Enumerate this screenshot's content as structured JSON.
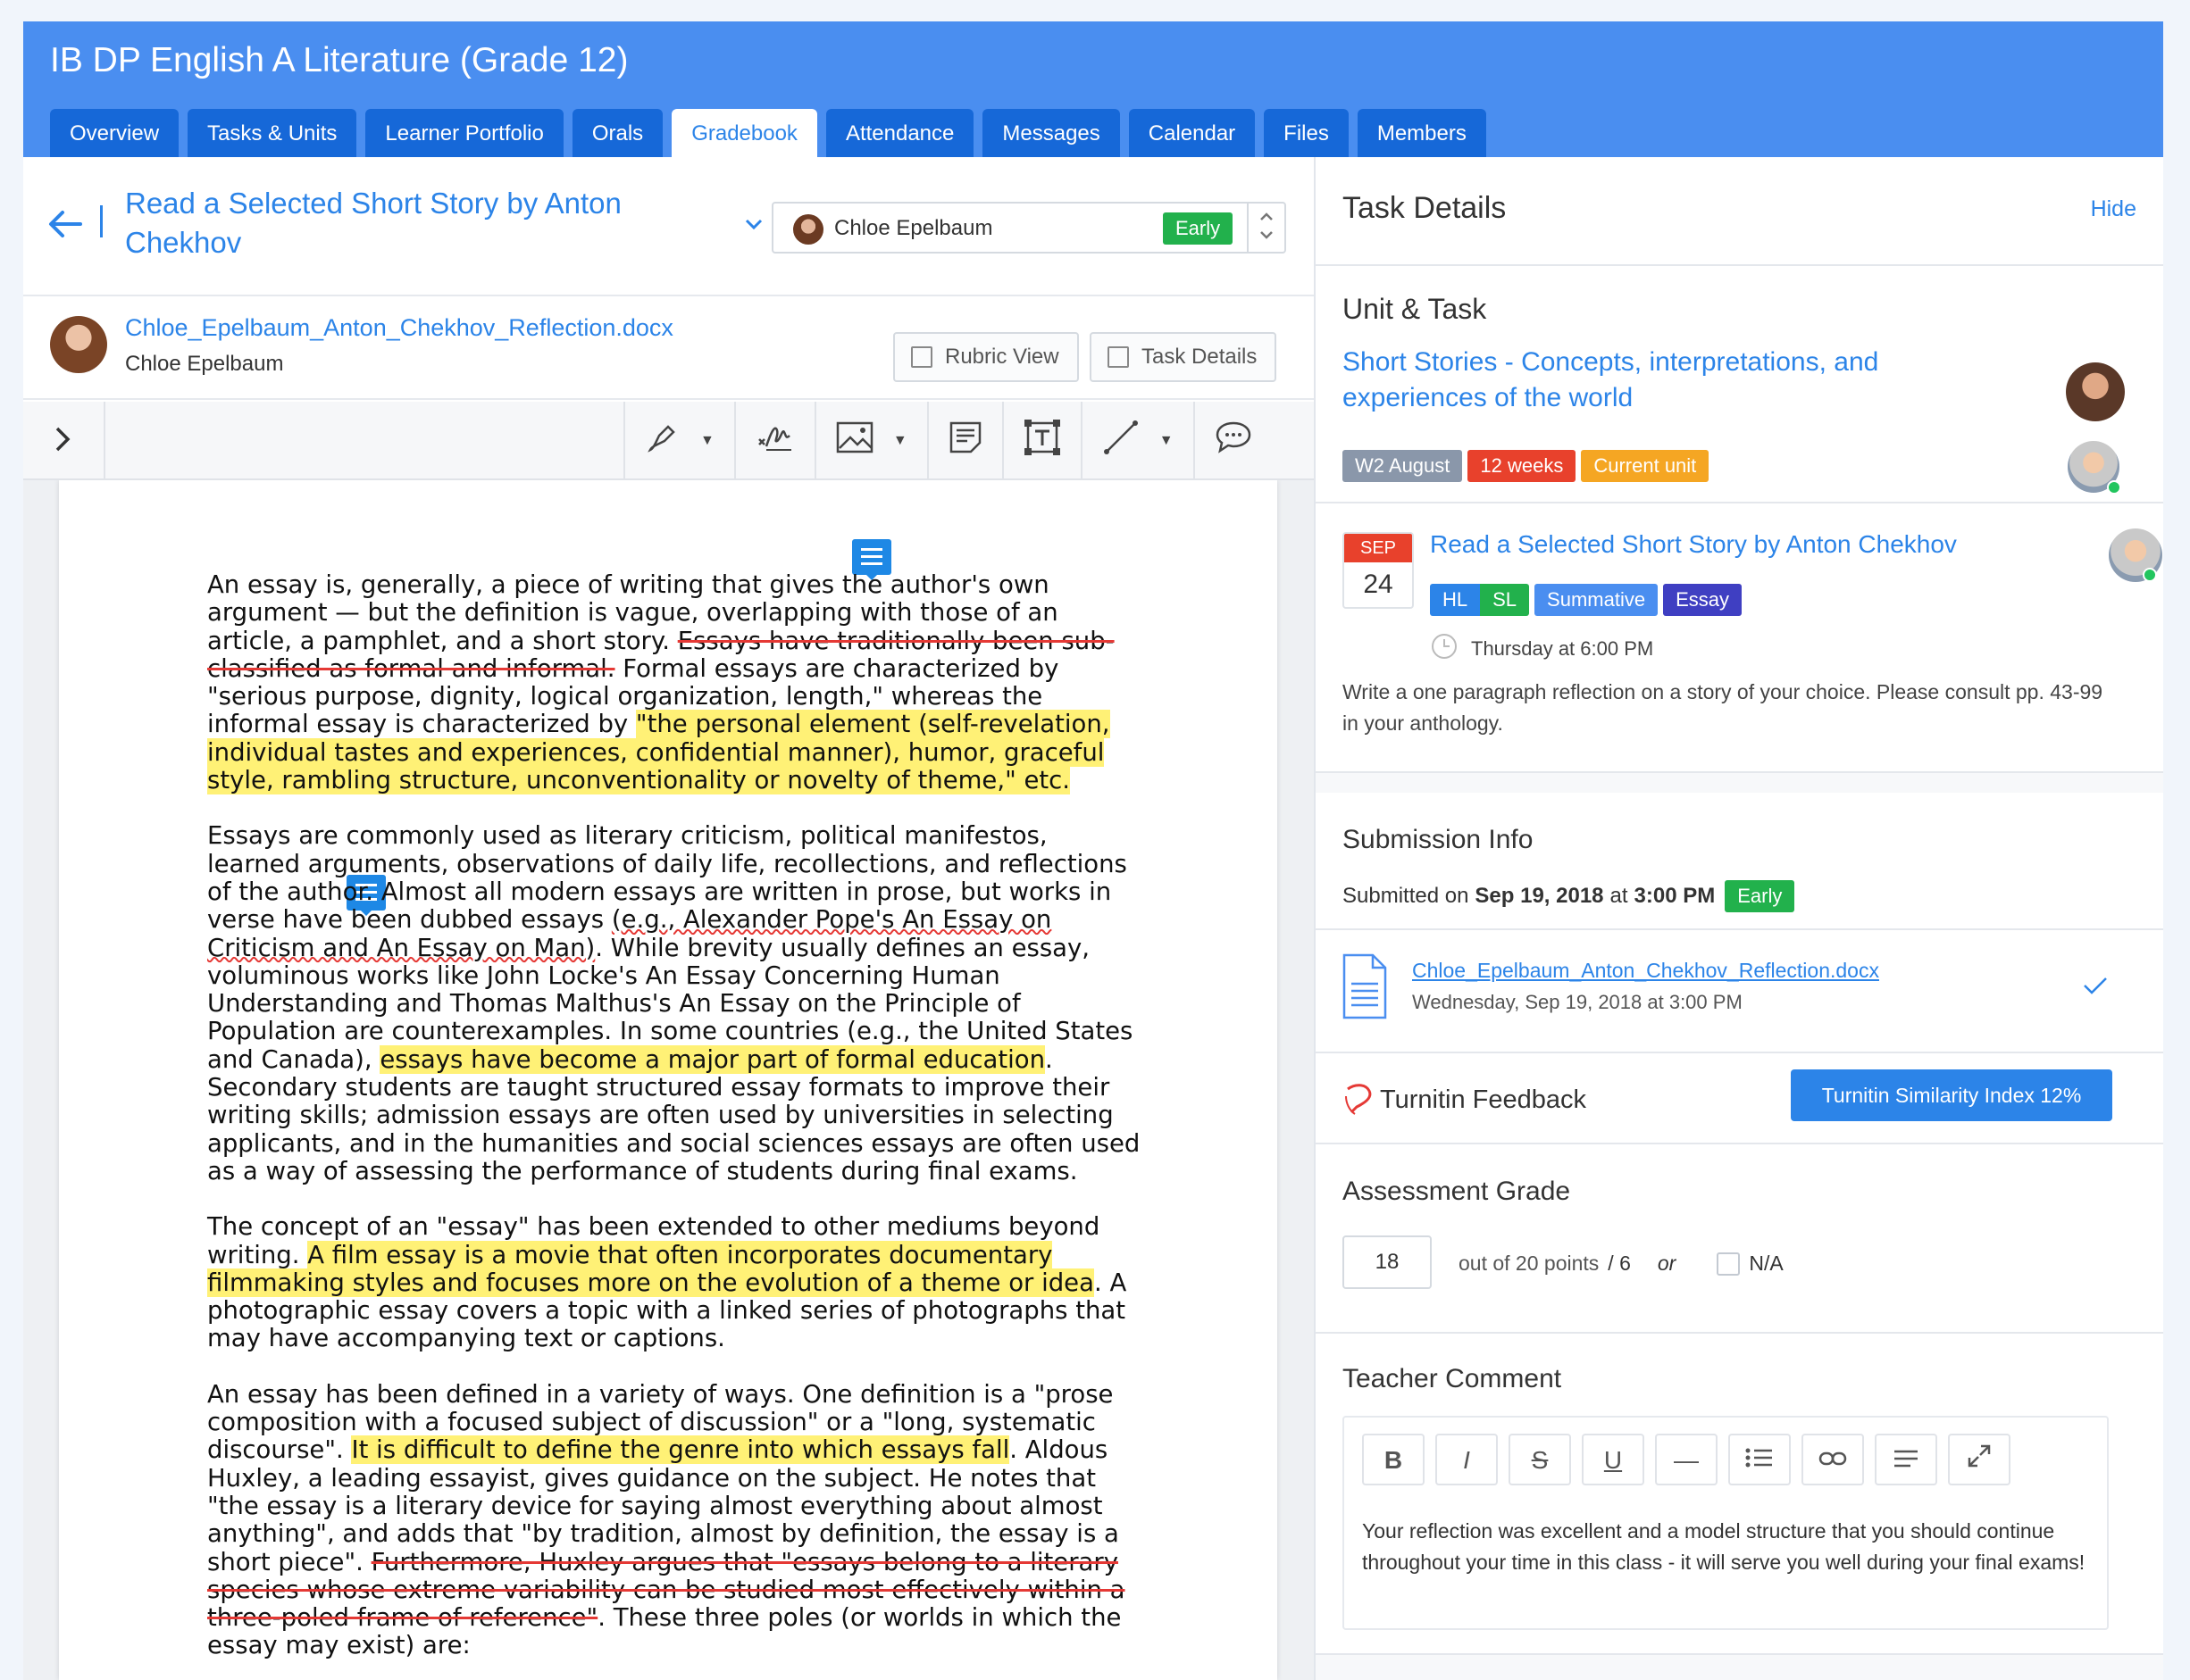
{
  "course_title": "IB DP English A Literature (Grade 12)",
  "tabs": [
    {
      "label": "Overview"
    },
    {
      "label": "Tasks & Units"
    },
    {
      "label": "Learner Portfolio"
    },
    {
      "label": "Orals"
    },
    {
      "label": "Gradebook",
      "active": true
    },
    {
      "label": "Attendance"
    },
    {
      "label": "Messages"
    },
    {
      "label": "Calendar"
    },
    {
      "label": "Files"
    },
    {
      "label": "Members"
    }
  ],
  "task": {
    "title": "Read a Selected Short Story by Anton Chekhov",
    "student_name": "Chloe Epelbaum",
    "status_badge": "Early"
  },
  "file": {
    "name": "Chloe_Epelbaum_Anton_Chekhov_Reflection.docx",
    "student": "Chloe Epelbaum",
    "rubric_view_label": "Rubric View",
    "task_details_label": "Task Details"
  },
  "document": {
    "p1": [
      {
        "t": "An essay is, generally, a piece of writing that gives the author's own argument — but the definition is vague, overlapping with those of an article, a pamphlet, and a short story. "
      },
      {
        "t": "Essays have traditionally been sub-classified as formal and informal.",
        "s": "st"
      },
      {
        "t": " Formal essays are characterized by \"serious purpose, dignity, logical organization, length,\" whereas the informal essay is characterized by "
      },
      {
        "t": "\"the personal element (self-revelation, individual tastes and experiences, confidential manner), humor, graceful style, rambling structure, unconventionality or novelty of theme,\" etc.",
        "s": "hl"
      }
    ],
    "p2": [
      {
        "t": "Essays are commonly used as literary criticism, political manifestos, learned arguments, observations of daily life, recollections, and reflections of the author. Almost all modern essays are written in prose, but works in verse have been dubbed essays "
      },
      {
        "t": "(e.g., Alexander Pope's An Essay on Criticism and An Essay on Man)",
        "s": "sq"
      },
      {
        "t": ". While brevity usually defines an essay, voluminous works like John Locke's An Essay Concerning Human Understanding and Thomas Malthus's An Essay on the Principle of Population are counterexamples. In some countries (e.g., the United States and Canada), "
      },
      {
        "t": "essays have become a major part of formal education",
        "s": "hl"
      },
      {
        "t": ". Secondary students are taught structured essay formats to improve their writing skills; admission essays are often used by universities in selecting applicants, and in the humanities and social sciences essays are often used as a way of assessing the performance of students during final exams."
      }
    ],
    "p3": [
      {
        "t": "The concept of an \"essay\" has been extended to other mediums beyond writing. "
      },
      {
        "t": "A film essay is a movie that often incorporates documentary filmmaking styles and focuses more on the evolution of a theme or idea",
        "s": "hl"
      },
      {
        "t": ". A photographic essay covers a topic with a linked series of photographs that may have accompanying text or captions."
      }
    ],
    "p4": [
      {
        "t": "An essay has been defined in a variety of ways. One definition is a \"prose composition with a focused subject of discussion\" or a \"long, systematic discourse\". "
      },
      {
        "t": "It is difficult to define the genre into which essays fall",
        "s": "hl"
      },
      {
        "t": ". Aldous Huxley, a leading essayist, gives guidance on the subject. He notes that \"the essay is a literary device for saying almost everything about almost anything\", and adds that \"by tradition, almost by definition, the essay is a short piece\". "
      },
      {
        "t": "Furthermore, Huxley argues that \"essays belong to a literary species whose extreme variability can be studied most effectively within a three-poled frame of reference\"",
        "s": "st"
      },
      {
        "t": ". These three poles (or worlds in which the essay may exist) are:"
      }
    ]
  },
  "details": {
    "title": "Task Details",
    "hide_label": "Hide",
    "unit_heading": "Unit & Task",
    "unit_name": "Short Stories - Concepts, interpretations, and experiences of the world",
    "unit_tags": [
      {
        "label": "W2 August",
        "color": "#8a97aa"
      },
      {
        "label": "12 weeks",
        "color": "#e8412c"
      },
      {
        "label": "Current unit",
        "color": "#f5a623"
      }
    ],
    "unit_progress": 0.16,
    "due_month": "SEP",
    "due_day": "24",
    "task_name": "Read a Selected Short Story by Anton Chekhov",
    "task_tags": [
      {
        "label": "HL",
        "color": "#2c84e8"
      },
      {
        "label": "SL",
        "color": "#22b14c"
      },
      {
        "label": "Summative",
        "color": "#4a8ef0"
      },
      {
        "label": "Essay",
        "color": "#3f3fc2"
      }
    ],
    "due_time": "Thursday at 6:00 PM",
    "description": "Write a one paragraph reflection on a story of your choice. Please consult pp. 43-99 in your anthology.",
    "submission_heading": "Submission Info",
    "submitted_prefix": "Submitted on",
    "submitted_date": "Sep 19, 2018",
    "submitted_at": "at",
    "submitted_time": "3:00 PM",
    "submitted_badge": "Early",
    "file_name": "Chloe_Epelbaum_Anton_Chekhov_Reflection.docx",
    "file_date": "Wednesday, Sep 19, 2018 at 3:00 PM",
    "turnitin_label": "Turnitin Feedback",
    "turnitin_button": "Turnitin Similarity Index 12%",
    "grade_heading": "Assessment Grade",
    "grade_value": "18",
    "grade_out_of": "out of 20 points",
    "grade_scale": "/ 6",
    "grade_or": "or",
    "grade_na": "N/A",
    "comment_heading": "Teacher Comment",
    "comment_text": "Your reflection was excellent and a model structure that you should continue throughout your time in this class - it will serve you well during your final exams!"
  },
  "colors": {
    "header": "#4a8ef0",
    "tab": "#1668d8",
    "link": "#2c84e8",
    "early": "#22b14c"
  }
}
